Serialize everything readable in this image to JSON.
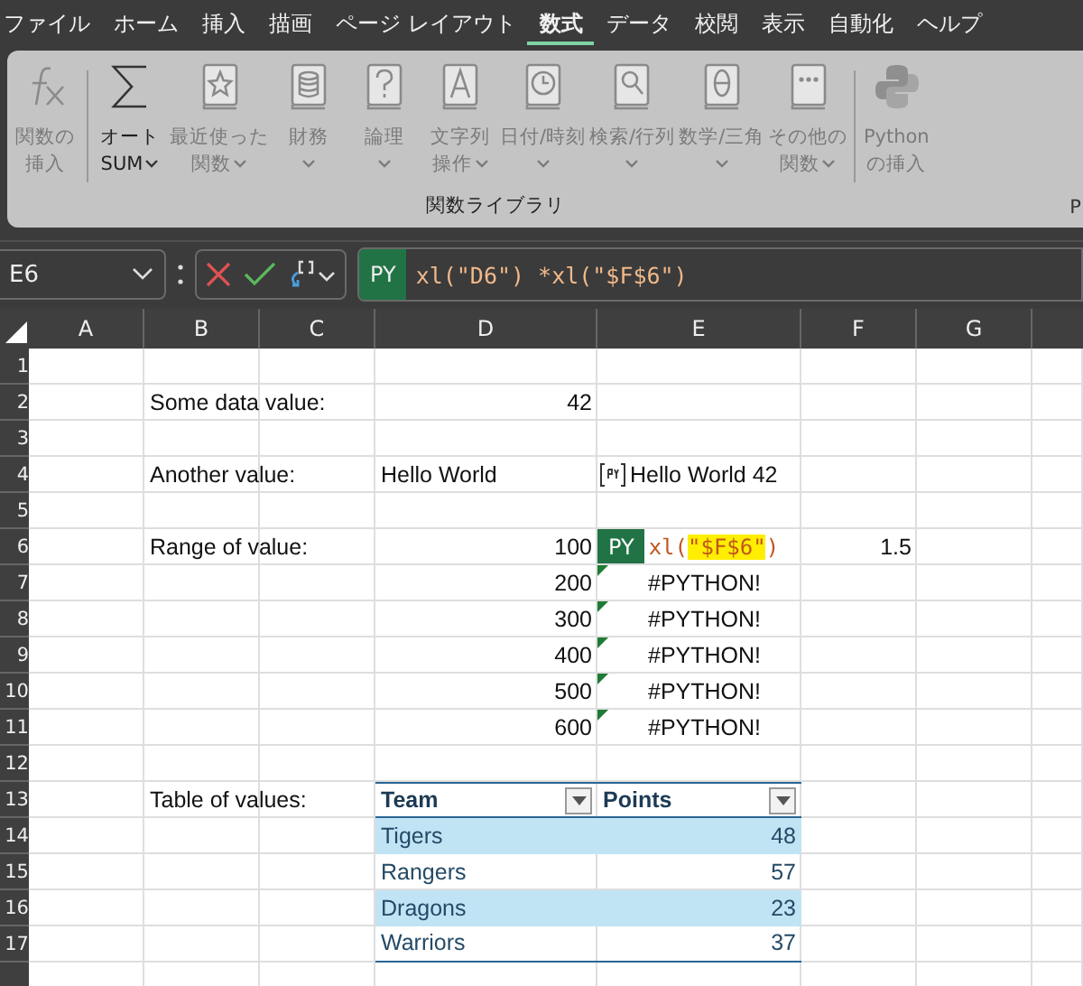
{
  "menu_tabs": [
    {
      "label": "ファイル",
      "selected": false
    },
    {
      "label": "ホーム",
      "selected": false
    },
    {
      "label": "挿入",
      "selected": false
    },
    {
      "label": "描画",
      "selected": false
    },
    {
      "label": "ページ レイアウト",
      "selected": false
    },
    {
      "label": "数式",
      "selected": true
    },
    {
      "label": "データ",
      "selected": false
    },
    {
      "label": "校閲",
      "selected": false
    },
    {
      "label": "表示",
      "selected": false
    },
    {
      "label": "自動化",
      "selected": false
    },
    {
      "label": "ヘルプ",
      "selected": false
    }
  ],
  "ribbon": {
    "group_label": "関数ライブラリ",
    "next_group_label": "P",
    "buttons": [
      {
        "kind": "fx",
        "lines": [
          "関数の",
          "挿入"
        ],
        "dropdown": false,
        "disabled": true,
        "separator_after": true
      },
      {
        "kind": "sigma",
        "lines": [
          "オート",
          "SUM"
        ],
        "dropdown": true,
        "disabled": false,
        "separator_after": false
      },
      {
        "kind": "book-star",
        "lines": [
          "最近使った",
          "関数"
        ],
        "dropdown": true,
        "disabled": true,
        "separator_after": false
      },
      {
        "kind": "book-database",
        "lines": [
          "財務"
        ],
        "dropdown": true,
        "disabled": true,
        "separator_after": false
      },
      {
        "kind": "book-question",
        "lines": [
          "論理"
        ],
        "dropdown": true,
        "disabled": true,
        "separator_after": false
      },
      {
        "kind": "book-letter",
        "lines": [
          "文字列",
          "操作"
        ],
        "dropdown": true,
        "disabled": true,
        "separator_after": false
      },
      {
        "kind": "book-clock",
        "lines": [
          "日付/時刻"
        ],
        "dropdown": true,
        "disabled": true,
        "separator_after": false
      },
      {
        "kind": "book-magnifier",
        "lines": [
          "検索/行列"
        ],
        "dropdown": true,
        "disabled": true,
        "separator_after": false
      },
      {
        "kind": "book-theta",
        "lines": [
          "数学/三角"
        ],
        "dropdown": true,
        "disabled": true,
        "separator_after": false
      },
      {
        "kind": "book-dots",
        "lines": [
          "その他の",
          "関数"
        ],
        "dropdown": true,
        "disabled": true,
        "separator_after": true
      },
      {
        "kind": "python",
        "lines": [
          "Python",
          "の挿入"
        ],
        "dropdown": false,
        "disabled": true,
        "separator_after": false
      }
    ]
  },
  "formula_bar": {
    "name_box": "E6",
    "badge": "PY",
    "formula": "xl(\"D6\") *xl(\"$F$6\")"
  },
  "columns": [
    "A",
    "B",
    "C",
    "D",
    "E",
    "F",
    "G"
  ],
  "rows": [
    {
      "number": "1",
      "cells": {}
    },
    {
      "number": "2",
      "cells": {
        "B": {
          "kind": "label",
          "text": "Some data value:"
        },
        "D": {
          "kind": "number",
          "text": "42"
        }
      }
    },
    {
      "number": "3",
      "cells": {}
    },
    {
      "number": "4",
      "cells": {
        "B": {
          "kind": "label",
          "text": "Another value:"
        },
        "D": {
          "kind": "label",
          "text": "Hello World"
        },
        "E": {
          "kind": "python_value",
          "text": "Hello World 42"
        }
      }
    },
    {
      "number": "5",
      "cells": {}
    },
    {
      "number": "6",
      "cells": {
        "B": {
          "kind": "label",
          "text": "Range of value:"
        },
        "D": {
          "kind": "number",
          "text": "100"
        },
        "E": {
          "kind": "python_formula",
          "badge": "PY",
          "segments": [
            {
              "text": "xl(",
              "highlight": false
            },
            {
              "text": "\"$F$6\"",
              "highlight": true
            },
            {
              "text": ")",
              "highlight": false
            }
          ]
        },
        "F": {
          "kind": "number",
          "text": "1.5"
        }
      }
    },
    {
      "number": "7",
      "cells": {
        "D": {
          "kind": "number",
          "text": "200"
        },
        "E": {
          "kind": "python_error",
          "text": "#PYTHON!",
          "error_flag": true
        }
      }
    },
    {
      "number": "8",
      "cells": {
        "D": {
          "kind": "number",
          "text": "300"
        },
        "E": {
          "kind": "python_error",
          "text": "#PYTHON!",
          "error_flag": true
        }
      }
    },
    {
      "number": "9",
      "cells": {
        "D": {
          "kind": "number",
          "text": "400"
        },
        "E": {
          "kind": "python_error",
          "text": "#PYTHON!",
          "error_flag": true
        }
      }
    },
    {
      "number": "10",
      "cells": {
        "D": {
          "kind": "number",
          "text": "500"
        },
        "E": {
          "kind": "python_error",
          "text": "#PYTHON!",
          "error_flag": true
        }
      }
    },
    {
      "number": "11",
      "cells": {
        "D": {
          "kind": "number",
          "text": "600"
        },
        "E": {
          "kind": "python_error",
          "text": "#PYTHON!",
          "error_flag": true
        }
      }
    },
    {
      "number": "12",
      "cells": {}
    },
    {
      "number": "13",
      "cells": {
        "B": {
          "kind": "label",
          "text": "Table of values:"
        },
        "D": {
          "kind": "table_header",
          "text": "Team",
          "filter": true
        },
        "E": {
          "kind": "table_header",
          "text": "Points",
          "filter": true
        }
      }
    },
    {
      "number": "14",
      "cells": {
        "D": {
          "kind": "table_text",
          "text": "Tigers",
          "banded": true
        },
        "E": {
          "kind": "table_number",
          "text": "48",
          "banded": true
        }
      }
    },
    {
      "number": "15",
      "cells": {
        "D": {
          "kind": "table_text",
          "text": "Rangers",
          "banded": false
        },
        "E": {
          "kind": "table_number",
          "text": "57",
          "banded": false
        }
      }
    },
    {
      "number": "16",
      "cells": {
        "D": {
          "kind": "table_text",
          "text": "Dragons",
          "banded": true
        },
        "E": {
          "kind": "table_number",
          "text": "23",
          "banded": true
        }
      }
    },
    {
      "number": "17",
      "cells": {
        "D": {
          "kind": "table_text",
          "text": "Warriors",
          "banded": false
        },
        "E": {
          "kind": "table_number",
          "text": "37",
          "banded": false
        }
      }
    }
  ]
}
